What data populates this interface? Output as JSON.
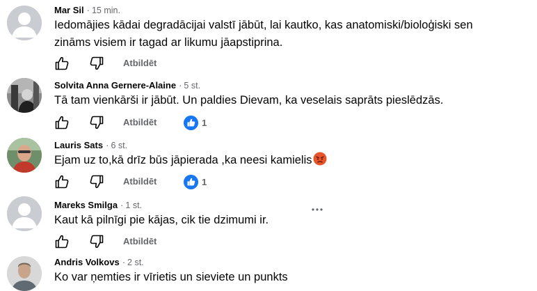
{
  "comments": [
    {
      "author": "Mar Sil",
      "time": "15 min.",
      "text_lines": [
        "Iedomājies kādai degradācijai valstī jābūt, lai kautko, kas anatomiski/bioloģiski sen",
        "zināms visiem ir tagad ar likumu jāapstiprina."
      ],
      "reply_label": "Atbildēt",
      "avatar": "default-avatar"
    },
    {
      "author": "Solvita Anna Gernere-Alaine",
      "time": "5 st.",
      "text_lines": [
        "Tā tam vienkārši ir jābūt. Un paldies Dievam, ka veselais saprāts pieslēdzās."
      ],
      "reply_label": "Atbildēt",
      "like_count": "1",
      "avatar": "photo-avatar"
    },
    {
      "author": "Lauris Sats",
      "time": "6 st.",
      "text_lines": [
        "Ejam uz to,kā drīz būs jāpierada ,ka neesi kamielis"
      ],
      "emoji": "angry-face-emoji",
      "reply_label": "Atbildēt",
      "like_count": "1",
      "avatar": "photo-avatar"
    },
    {
      "author": "Mareks Smilga",
      "time": "1 st.",
      "text_lines": [
        "Kaut kā pilnīgi pie kājas, cik tie dzimumi ir."
      ],
      "reply_label": "Atbildēt",
      "avatar": "default-avatar",
      "more_icon": "more-options-icon"
    },
    {
      "author": "Andris Volkovs",
      "time": "2 st.",
      "text_lines": [
        "Ko var ņemties ir vīrietis un sieviete un punkts"
      ],
      "avatar": "photo-avatar"
    }
  ],
  "separator": "·",
  "icons": {
    "like": "thumbs-up-icon",
    "dislike": "thumbs-down-icon",
    "reaction": "like-reaction-icon"
  },
  "colors": {
    "meta_text": "#65676b",
    "reaction_blue": "#1877f2",
    "avatar_placeholder": "#c9ccd1"
  }
}
